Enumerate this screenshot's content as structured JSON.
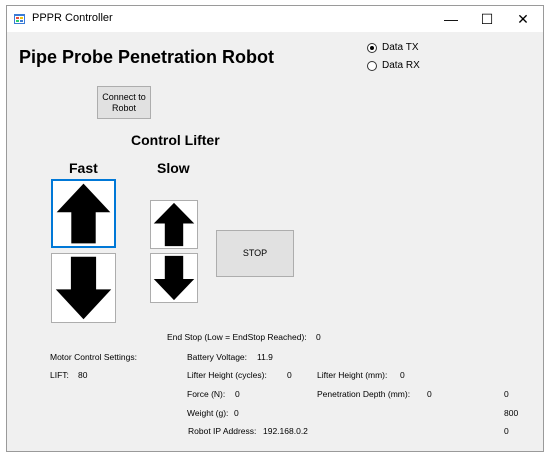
{
  "window": {
    "title": "PPPR Controller",
    "minimize_glyph": "—",
    "maximize_glyph": "☐",
    "close_glyph": "✕"
  },
  "heading": "Pipe Probe Penetration Robot",
  "radios": [
    {
      "label": "Data TX",
      "selected": true
    },
    {
      "label": "Data RX",
      "selected": false
    }
  ],
  "connect_button": {
    "line1": "Connect to",
    "line2": "Robot"
  },
  "control_lifter": "Control Lifter",
  "fast_label": "Fast",
  "slow_label": "Slow",
  "stop_button": "STOP",
  "end_stop": {
    "label": "End Stop (Low = EndStop Reached):",
    "value": "0"
  },
  "motor_settings": "Motor Control Settings:",
  "lift": {
    "label": "LIFT:",
    "value": "80"
  },
  "battery": {
    "label": "Battery Voltage:",
    "value": "11.9"
  },
  "lifter_cycles": {
    "label": "Lifter Height (cycles):",
    "value": "0"
  },
  "lifter_mm": {
    "label": "Lifter Height (mm):",
    "value": "0"
  },
  "force": {
    "label": "Force (N):",
    "value": "0"
  },
  "penetration": {
    "label": "Penetration Depth (mm):",
    "value": "0"
  },
  "weight": {
    "label": "Weight (g):",
    "value": "0"
  },
  "ip": {
    "label": "Robot IP Address:",
    "value": "192.168.0.2"
  },
  "right_column": [
    "0",
    "800",
    "0"
  ],
  "icons": {
    "app": "app-window-icon",
    "up": "arrow-up-icon",
    "down": "arrow-down-icon"
  },
  "colors": {
    "focus_border": "#0078d7",
    "button_face": "#e1e1e1",
    "window_bg": "#f0f0f0"
  }
}
